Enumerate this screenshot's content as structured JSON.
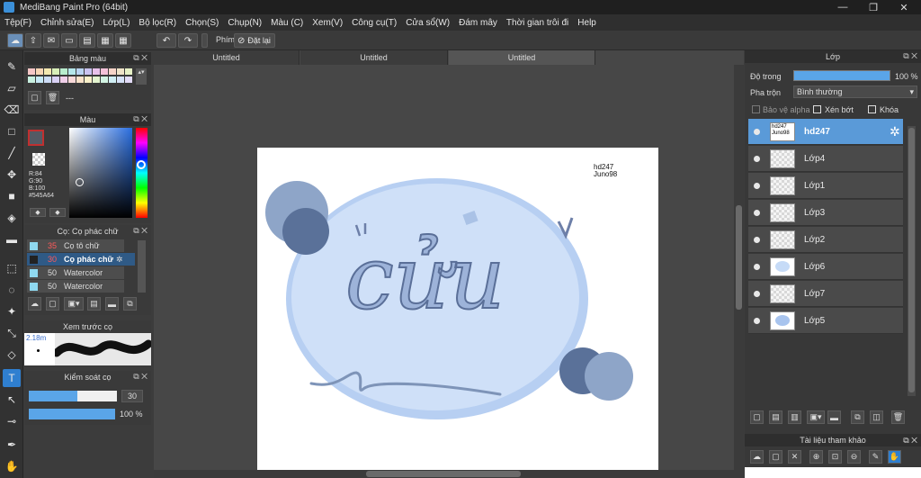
{
  "app": {
    "title": "MediBang Paint Pro (64bit)",
    "minimize": "—",
    "maximize": "❐",
    "close": "✕"
  },
  "menu": [
    "Tệp(F)",
    "Chỉnh sửa(E)",
    "Lớp(L)",
    "Bộ lọc(R)",
    "Chọn(S)",
    "Chụp(N)",
    "Màu (C)",
    "Xem(V)",
    "Công cụ(T)",
    "Cửa sổ(W)",
    "Đám mây",
    "Thời gian trôi đi",
    "Help"
  ],
  "toolbar": {
    "shortcut_label": "Phím",
    "reset_label": "Đặt lại"
  },
  "palette": {
    "title": "Bảng màu",
    "empty_label": "---"
  },
  "color": {
    "title": "Màu",
    "r": "R:84",
    "g": "G:90",
    "b": "B:100",
    "hex": "#545A64",
    "primary": "#545A64"
  },
  "brush": {
    "title": "Cọ: Cọ phác chữ",
    "items": [
      {
        "size": "35",
        "name": "Cọ tô chữ",
        "size_color": "#ff5a5a"
      },
      {
        "size": "30",
        "name": "Cọ phác chữ",
        "size_color": "#ff5a5a"
      },
      {
        "size": "50",
        "name": "Watercolor",
        "size_color": "#e0e0e0"
      },
      {
        "size": "50",
        "name": "Watercolor",
        "size_color": "#e0e0e0"
      }
    ]
  },
  "preview": {
    "title": "Xem trước cọ",
    "size": "2.18m"
  },
  "control": {
    "title": "Kiểm soát cọ",
    "size_value": "30",
    "opacity_value": "100 %"
  },
  "tabs": [
    "Untitled",
    "Untitled",
    "Untitled"
  ],
  "canvas": {
    "signature1": "hd247",
    "signature2": "Juno98",
    "main_text": "cửu"
  },
  "layers_panel": {
    "title": "Lớp",
    "opacity_label": "Độ trong",
    "opacity_value": "100 %",
    "blend_label": "Pha trộn",
    "blend_value": "Bình thường",
    "protect_alpha": "Bảo vệ alpha",
    "clip": "Xén bớt",
    "lock": "Khóa"
  },
  "layers": [
    {
      "name": "hd247",
      "thumb_text": "hd247 Juno98",
      "selected": true
    },
    {
      "name": "Lớp4",
      "selected": false
    },
    {
      "name": "Lớp1",
      "selected": false
    },
    {
      "name": "Lớp3",
      "selected": false
    },
    {
      "name": "Lớp2",
      "selected": false
    },
    {
      "name": "Lớp6",
      "selected": false
    },
    {
      "name": "Lớp7",
      "selected": false
    },
    {
      "name": "Lớp5",
      "selected": false
    }
  ],
  "reference": {
    "title": "Tài liệu tham khảo"
  }
}
